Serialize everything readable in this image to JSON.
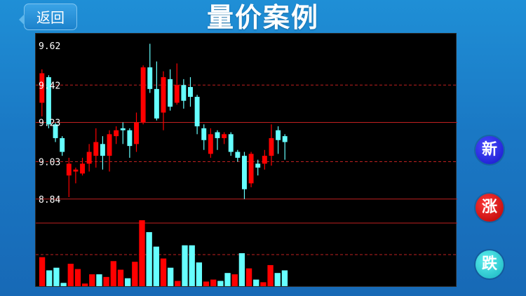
{
  "header": {
    "back_label": "返回",
    "title": "量价案例"
  },
  "side_buttons": {
    "new_label": "新",
    "rise_label": "涨",
    "fall_label": "跌"
  },
  "colors": {
    "up": "#ff0000",
    "down": "#66ffff",
    "grid_dashed": "#c02020",
    "grid_solid": "#c02020"
  },
  "chart_data": {
    "type": "candlestick",
    "y_ticks": [
      "9.62",
      "9.42",
      "9.23",
      "9.03",
      "8.84"
    ],
    "ylim": [
      8.8,
      9.66
    ],
    "candles": [
      {
        "o": 9.33,
        "c": 9.48,
        "h": 9.5,
        "l": 9.26,
        "dir": "up"
      },
      {
        "o": 9.46,
        "c": 9.22,
        "h": 9.47,
        "l": 9.2,
        "dir": "down"
      },
      {
        "o": 9.22,
        "c": 9.15,
        "h": 9.23,
        "l": 9.13,
        "dir": "down"
      },
      {
        "o": 9.15,
        "c": 9.08,
        "h": 9.16,
        "l": 9.06,
        "dir": "down"
      },
      {
        "o": 8.96,
        "c": 9.02,
        "h": 9.05,
        "l": 8.85,
        "dir": "up"
      },
      {
        "o": 8.98,
        "c": 8.99,
        "h": 9.0,
        "l": 8.92,
        "dir": "up"
      },
      {
        "o": 8.97,
        "c": 9.02,
        "h": 9.05,
        "l": 8.96,
        "dir": "up"
      },
      {
        "o": 9.02,
        "c": 9.08,
        "h": 9.12,
        "l": 8.98,
        "dir": "up"
      },
      {
        "o": 9.06,
        "c": 9.13,
        "h": 9.2,
        "l": 9.0,
        "dir": "up"
      },
      {
        "o": 9.12,
        "c": 9.06,
        "h": 9.16,
        "l": 8.99,
        "dir": "down"
      },
      {
        "o": 9.06,
        "c": 9.17,
        "h": 9.19,
        "l": 8.98,
        "dir": "up"
      },
      {
        "o": 9.16,
        "c": 9.19,
        "h": 9.21,
        "l": 9.12,
        "dir": "up"
      },
      {
        "o": 9.2,
        "c": 9.19,
        "h": 9.23,
        "l": 9.12,
        "dir": "down"
      },
      {
        "o": 9.19,
        "c": 9.11,
        "h": 9.2,
        "l": 9.05,
        "dir": "down"
      },
      {
        "o": 9.12,
        "c": 9.23,
        "h": 9.28,
        "l": 9.08,
        "dir": "up"
      },
      {
        "o": 9.23,
        "c": 9.51,
        "h": 9.52,
        "l": 9.22,
        "dir": "up"
      },
      {
        "o": 9.51,
        "c": 9.4,
        "h": 9.63,
        "l": 9.38,
        "dir": "down"
      },
      {
        "o": 9.4,
        "c": 9.25,
        "h": 9.54,
        "l": 9.24,
        "dir": "down"
      },
      {
        "o": 9.28,
        "c": 9.46,
        "h": 9.49,
        "l": 9.19,
        "dir": "up"
      },
      {
        "o": 9.45,
        "c": 9.31,
        "h": 9.5,
        "l": 9.29,
        "dir": "down"
      },
      {
        "o": 9.33,
        "c": 9.42,
        "h": 9.53,
        "l": 9.32,
        "dir": "up"
      },
      {
        "o": 9.42,
        "c": 9.34,
        "h": 9.45,
        "l": 9.3,
        "dir": "down"
      },
      {
        "o": 9.41,
        "c": 9.36,
        "h": 9.46,
        "l": 9.31,
        "dir": "down"
      },
      {
        "o": 9.36,
        "c": 9.21,
        "h": 9.37,
        "l": 9.17,
        "dir": "down"
      },
      {
        "o": 9.2,
        "c": 9.14,
        "h": 9.22,
        "l": 9.09,
        "dir": "down"
      },
      {
        "o": 9.07,
        "c": 9.17,
        "h": 9.2,
        "l": 9.05,
        "dir": "up"
      },
      {
        "o": 9.18,
        "c": 9.15,
        "h": 9.19,
        "l": 9.09,
        "dir": "down"
      },
      {
        "o": 9.15,
        "c": 9.17,
        "h": 9.18,
        "l": 9.12,
        "dir": "up"
      },
      {
        "o": 9.17,
        "c": 9.08,
        "h": 9.18,
        "l": 9.06,
        "dir": "down"
      },
      {
        "o": 9.08,
        "c": 9.05,
        "h": 9.09,
        "l": 9.03,
        "dir": "down"
      },
      {
        "o": 9.06,
        "c": 8.89,
        "h": 9.08,
        "l": 8.84,
        "dir": "down"
      },
      {
        "o": 8.92,
        "c": 9.07,
        "h": 9.08,
        "l": 8.9,
        "dir": "up"
      },
      {
        "o": 9.02,
        "c": 9.0,
        "h": 9.04,
        "l": 8.96,
        "dir": "down"
      },
      {
        "o": 9.02,
        "c": 9.06,
        "h": 9.09,
        "l": 8.99,
        "dir": "up"
      },
      {
        "o": 9.06,
        "c": 9.15,
        "h": 9.22,
        "l": 9.01,
        "dir": "up"
      },
      {
        "o": 9.19,
        "c": 9.14,
        "h": 9.21,
        "l": 9.07,
        "dir": "down"
      },
      {
        "o": 9.16,
        "c": 9.13,
        "h": 9.17,
        "l": 9.04,
        "dir": "down"
      }
    ],
    "volumes": [
      {
        "v": 0.44,
        "dir": "up"
      },
      {
        "v": 0.24,
        "dir": "down"
      },
      {
        "v": 0.28,
        "dir": "down"
      },
      {
        "v": 0.05,
        "dir": "down"
      },
      {
        "v": 0.34,
        "dir": "up"
      },
      {
        "v": 0.26,
        "dir": "up"
      },
      {
        "v": 0.04,
        "dir": "up"
      },
      {
        "v": 0.18,
        "dir": "up"
      },
      {
        "v": 0.18,
        "dir": "down"
      },
      {
        "v": 0.14,
        "dir": "up"
      },
      {
        "v": 0.38,
        "dir": "up"
      },
      {
        "v": 0.25,
        "dir": "up"
      },
      {
        "v": 0.12,
        "dir": "down"
      },
      {
        "v": 0.37,
        "dir": "up"
      },
      {
        "v": 1.0,
        "dir": "up"
      },
      {
        "v": 0.82,
        "dir": "down"
      },
      {
        "v": 0.6,
        "dir": "down"
      },
      {
        "v": 0.42,
        "dir": "up"
      },
      {
        "v": 0.28,
        "dir": "down"
      },
      {
        "v": 0.08,
        "dir": "up"
      },
      {
        "v": 0.62,
        "dir": "down"
      },
      {
        "v": 0.62,
        "dir": "down"
      },
      {
        "v": 0.36,
        "dir": "down"
      },
      {
        "v": 0.07,
        "dir": "up"
      },
      {
        "v": 0.1,
        "dir": "up"
      },
      {
        "v": 0.08,
        "dir": "down"
      },
      {
        "v": 0.2,
        "dir": "down"
      },
      {
        "v": 0.18,
        "dir": "up"
      },
      {
        "v": 0.5,
        "dir": "down"
      },
      {
        "v": 0.27,
        "dir": "up"
      },
      {
        "v": 0.1,
        "dir": "down"
      },
      {
        "v": 0.06,
        "dir": "up"
      },
      {
        "v": 0.32,
        "dir": "up"
      },
      {
        "v": 0.2,
        "dir": "down"
      },
      {
        "v": 0.24,
        "dir": "down"
      }
    ]
  }
}
